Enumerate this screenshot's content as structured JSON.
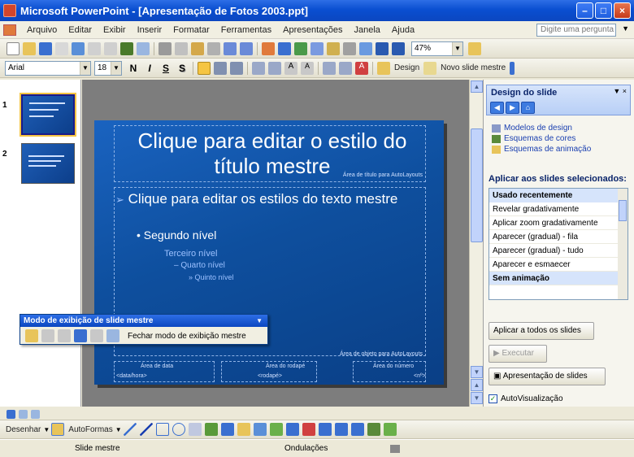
{
  "window": {
    "title": "Microsoft PowerPoint - [Apresentação de Fotos 2003.ppt]",
    "minimize_glyph": "–",
    "maximize_glyph": "□",
    "close_glyph": "×"
  },
  "menu": {
    "items": [
      "Arquivo",
      "Editar",
      "Exibir",
      "Inserir",
      "Formatar",
      "Ferramentas",
      "Apresentações",
      "Janela",
      "Ajuda"
    ],
    "ask_placeholder": "Digite uma pergunta"
  },
  "format_toolbar": {
    "font": "Arial",
    "size": "18",
    "bold": "N",
    "italic": "I",
    "underline": "S",
    "shadow": "S",
    "zoom": "47%",
    "design_label": "Design",
    "new_master_label": "Novo slide mestre"
  },
  "slides_pane": {
    "numbers": [
      "1",
      "2"
    ]
  },
  "slide": {
    "title": "Clique para editar o estilo do título mestre",
    "title_area_label": "Área de título para AutoLayouts",
    "level1": "Clique para editar os estilos do texto mestre",
    "level1_bullet": "➢",
    "level2": "• Segundo nível",
    "level3": "Terceiro nível",
    "level4": "– Quarto nível",
    "level5": "» Quinto nível",
    "object_area_label": "Área de objeto para AutoLayouts",
    "date_area_label": "Área de data",
    "date_area_sub": "<data/hora>",
    "footer_area_label": "Área do rodapé",
    "footer_area_sub": "<rodapé>",
    "number_area_label": "Área do número",
    "number_area_sub": "<nº>"
  },
  "master_toolbar": {
    "title": "Modo de exibição de slide mestre",
    "close_label": "Fechar modo de exibição mestre"
  },
  "task_pane": {
    "title": "Design do slide",
    "links": [
      "Modelos de design",
      "Esquemas de cores",
      "Esquemas de animação"
    ],
    "apply_heading": "Aplicar aos slides selecionados:",
    "list_group": "Usado recentemente",
    "list_items": [
      "Revelar gradativamente",
      "Aplicar zoom gradativamente",
      "Aparecer (gradual) - fila",
      "Aparecer (gradual) - tudo",
      "Aparecer e esmaecer"
    ],
    "selected_item": "Sem animação",
    "apply_all_button": "Aplicar a todos os slides",
    "play_button": "Executar",
    "slideshow_button": "Apresentação de slides",
    "autopreview_label": "AutoVisualização",
    "autopreview_checked": "✓"
  },
  "drawing_toolbar": {
    "draw_label": "Desenhar",
    "autoshapes_label": "AutoFormas"
  },
  "status": {
    "view": "Slide mestre",
    "design": "Ondulações"
  },
  "colors": {
    "titlebar": "#0a4fd1",
    "slide_bg": "#0e4f9e",
    "task_heading": "#0a246a",
    "link": "#1a3fb0"
  }
}
